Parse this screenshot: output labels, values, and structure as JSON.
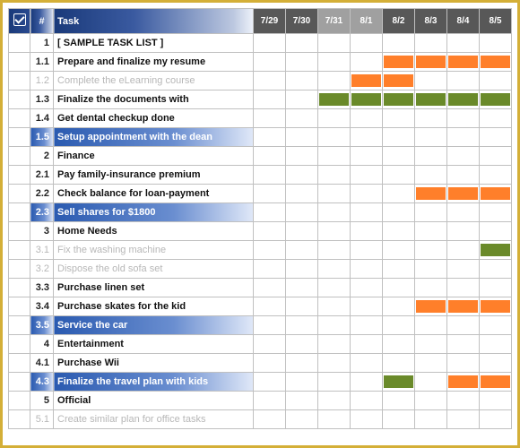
{
  "header": {
    "check": "✓",
    "num": "#",
    "task": "Task",
    "dates": [
      "7/29",
      "7/30",
      "7/31",
      "8/1",
      "8/2",
      "8/3",
      "8/4",
      "8/5"
    ],
    "mid_dates": [
      2,
      3
    ]
  },
  "rows": [
    {
      "num": "1",
      "task": "[ SAMPLE TASK LIST ]",
      "style": "normal",
      "bars": []
    },
    {
      "num": "1.1",
      "task": "Prepare and finalize my resume",
      "style": "normal",
      "bars": [
        {
          "from": 4,
          "to": 7,
          "color": "orange"
        }
      ]
    },
    {
      "num": "1.2",
      "task": "Complete the eLearning course",
      "style": "muted",
      "bars": [
        {
          "from": 3,
          "to": 4,
          "color": "orange"
        }
      ]
    },
    {
      "num": "1.3",
      "task": "Finalize the documents with",
      "style": "normal",
      "bars": [
        {
          "from": 2,
          "to": 7,
          "color": "green"
        }
      ]
    },
    {
      "num": "1.4",
      "task": "Get dental checkup done",
      "style": "normal",
      "bars": []
    },
    {
      "num": "1.5",
      "task": "Setup appointment with the dean",
      "style": "hl",
      "bars": []
    },
    {
      "num": "2",
      "task": "Finance",
      "style": "normal",
      "bars": []
    },
    {
      "num": "2.1",
      "task": "Pay family-insurance premium",
      "style": "normal",
      "bars": []
    },
    {
      "num": "2.2",
      "task": "Check balance for loan-payment",
      "style": "normal",
      "bars": [
        {
          "from": 5,
          "to": 7,
          "color": "orange"
        }
      ]
    },
    {
      "num": "2.3",
      "task": "Sell shares for $1800",
      "style": "hl",
      "bars": []
    },
    {
      "num": "3",
      "task": "Home Needs",
      "style": "normal",
      "bars": []
    },
    {
      "num": "3.1",
      "task": "Fix the washing machine",
      "style": "muted",
      "bars": [
        {
          "from": 7,
          "to": 7,
          "color": "green"
        }
      ]
    },
    {
      "num": "3.2",
      "task": "Dispose the old sofa set",
      "style": "muted",
      "bars": []
    },
    {
      "num": "3.3",
      "task": "Purchase linen set",
      "style": "normal",
      "bars": []
    },
    {
      "num": "3.4",
      "task": "Purchase skates for the kid",
      "style": "normal",
      "bars": [
        {
          "from": 5,
          "to": 7,
          "color": "orange"
        }
      ]
    },
    {
      "num": "3.5",
      "task": "Service the car",
      "style": "hl",
      "bars": []
    },
    {
      "num": "4",
      "task": "Entertainment",
      "style": "normal",
      "bars": []
    },
    {
      "num": "4.1",
      "task": "Purchase Wii",
      "style": "normal",
      "bars": []
    },
    {
      "num": "4.3",
      "task": "Finalize the travel plan with kids",
      "style": "hl",
      "bars": [
        {
          "from": 4,
          "to": 4,
          "color": "green"
        },
        {
          "from": 6,
          "to": 7,
          "color": "orange"
        }
      ]
    },
    {
      "num": "5",
      "task": "Official",
      "style": "normal",
      "bars": []
    },
    {
      "num": "5.1",
      "task": "Create similar plan for office tasks",
      "style": "muted",
      "bars": []
    }
  ],
  "chart_data": {
    "type": "table",
    "title": "Task timeline (Gantt)",
    "columns": [
      "7/29",
      "7/30",
      "7/31",
      "8/1",
      "8/2",
      "8/3",
      "8/4",
      "8/5"
    ],
    "series": [
      {
        "name": "Prepare and finalize my resume",
        "color": "orange",
        "span": [
          "8/2",
          "8/5"
        ]
      },
      {
        "name": "Complete the eLearning course",
        "color": "orange",
        "span": [
          "8/1",
          "8/2"
        ]
      },
      {
        "name": "Finalize the documents with",
        "color": "green",
        "span": [
          "7/31",
          "8/5"
        ]
      },
      {
        "name": "Check balance for loan-payment",
        "color": "orange",
        "span": [
          "8/3",
          "8/5"
        ]
      },
      {
        "name": "Fix the washing machine",
        "color": "green",
        "span": [
          "8/5",
          "8/5"
        ]
      },
      {
        "name": "Purchase skates for the kid",
        "color": "orange",
        "span": [
          "8/3",
          "8/5"
        ]
      },
      {
        "name": "Finalize the travel plan with kids (a)",
        "color": "green",
        "span": [
          "8/2",
          "8/2"
        ]
      },
      {
        "name": "Finalize the travel plan with kids (b)",
        "color": "orange",
        "span": [
          "8/4",
          "8/5"
        ]
      }
    ]
  }
}
